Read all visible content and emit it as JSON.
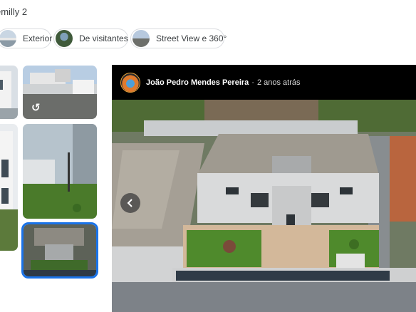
{
  "page": {
    "title": "emilly 2"
  },
  "filters": [
    {
      "label": "Exterior"
    },
    {
      "label": "De visitantes"
    },
    {
      "label": "Street View e 360°"
    }
  ],
  "viewer": {
    "author": "João Pedro Mendes Pereira",
    "separator": "·",
    "time_ago": "2 anos atrás",
    "prev_icon": "chevron-left-icon"
  },
  "gallery": {
    "rotate_icon": "↺"
  }
}
